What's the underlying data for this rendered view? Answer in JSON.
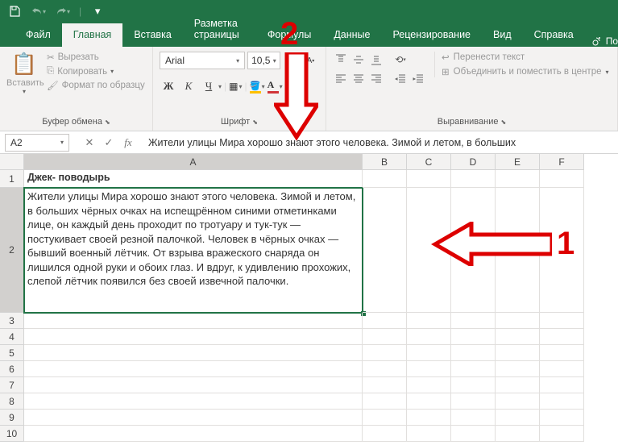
{
  "tabs": {
    "file": "Файл",
    "home": "Главная",
    "insert": "Вставка",
    "pageLayout": "Разметка страницы",
    "formulas": "Формулы",
    "data": "Данные",
    "review": "Рецензирование",
    "view": "Вид",
    "help": "Справка",
    "tell": "По"
  },
  "clipboard": {
    "paste": "Вставить",
    "cut": "Вырезать",
    "copy": "Копировать",
    "formatPainter": "Формат по образцу",
    "groupLabel": "Буфер обмена"
  },
  "font": {
    "name": "Arial",
    "size": "10,5",
    "groupLabel": "Шрифт",
    "bold": "Ж",
    "italic": "К",
    "underline": "Ч"
  },
  "alignment": {
    "wrap": "Перенести текст",
    "merge": "Объединить и поместить в центре",
    "groupLabel": "Выравнивание"
  },
  "nameBox": "A2",
  "formulaText": "Жители улицы Мира хорошо знают этого человека. Зимой и летом, в больших",
  "columns": [
    "A",
    "B",
    "C",
    "D",
    "E",
    "F"
  ],
  "rows": [
    "1",
    "2",
    "3",
    "4",
    "5",
    "6",
    "7",
    "8",
    "9",
    "10"
  ],
  "cells": {
    "a1": "Джек- поводырь",
    "a2": "Жители улицы Мира хорошо знают этого человека. Зимой и летом, в больших чёрных очках на испещрённом синими отметинками лице, он каждый день проходит по тротуару и тук-тук — постукивает своей резной палочкой. Человек в чёрных очках — бывший военный лётчик. От взрыва вражеского снаряда он лишился одной руки и обоих глаз. И вдруг, к удивлению прохожих, слепой лётчик появился без своей извечной палочки."
  },
  "annotations": {
    "one": "1",
    "two": "2"
  }
}
